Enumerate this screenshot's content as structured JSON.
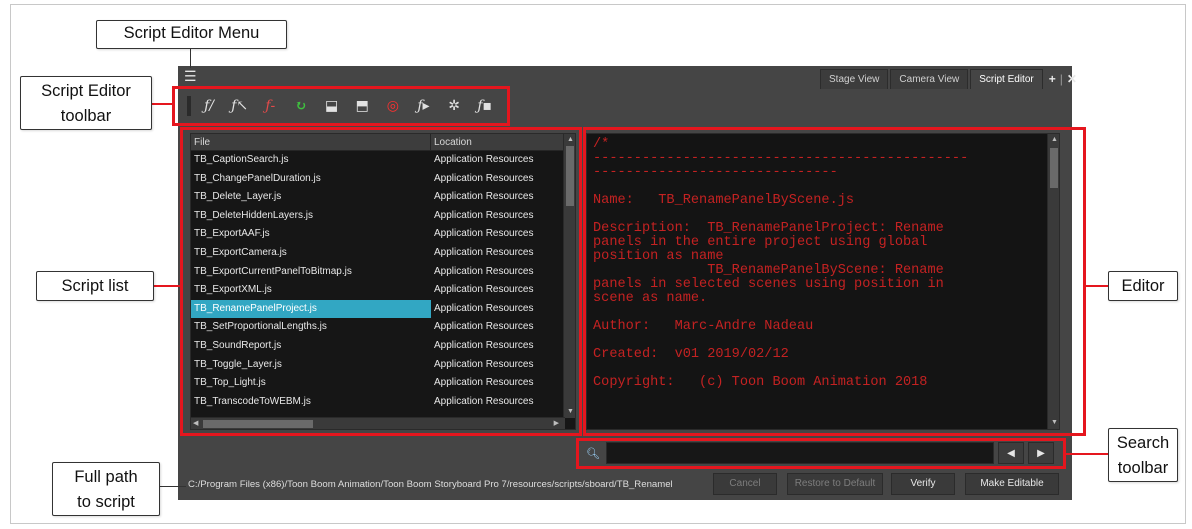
{
  "window": {
    "tabs": [
      {
        "label": "Stage View"
      },
      {
        "label": "Camera View"
      },
      {
        "label": "Script Editor"
      }
    ],
    "tab_controls": {
      "add": "+",
      "sep": "|",
      "close": "✕"
    }
  },
  "toolbar": {
    "buttons": [
      {
        "icon": "ƒ/",
        "name": "new-script-icon"
      },
      {
        "icon": "ƒ↖",
        "name": "import-script-icon"
      },
      {
        "icon": "ƒ-",
        "name": "delete-script-icon"
      },
      {
        "icon": "↻",
        "name": "refresh-icon"
      },
      {
        "icon": "⬓",
        "name": "import-resources-icon"
      },
      {
        "icon": "⬒",
        "name": "export-resources-icon"
      },
      {
        "icon": "◎",
        "name": "set-target-icon"
      },
      {
        "icon": "ƒ▸",
        "name": "run-icon"
      },
      {
        "icon": "✲",
        "name": "debug-icon"
      },
      {
        "icon": "ƒ▪",
        "name": "stop-icon"
      }
    ]
  },
  "script_list": {
    "headers": {
      "file": "File",
      "location": "Location"
    },
    "rows": [
      {
        "file": "TB_CaptionSearch.js",
        "location": "Application Resources"
      },
      {
        "file": "TB_ChangePanelDuration.js",
        "location": "Application Resources"
      },
      {
        "file": "TB_Delete_Layer.js",
        "location": "Application Resources"
      },
      {
        "file": "TB_DeleteHiddenLayers.js",
        "location": "Application Resources"
      },
      {
        "file": "TB_ExportAAF.js",
        "location": "Application Resources"
      },
      {
        "file": "TB_ExportCamera.js",
        "location": "Application Resources"
      },
      {
        "file": "TB_ExportCurrentPanelToBitmap.js",
        "location": "Application Resources"
      },
      {
        "file": "TB_ExportXML.js",
        "location": "Application Resources"
      },
      {
        "file": "TB_RenamePanelProject.js",
        "location": "Application Resources",
        "selected": true
      },
      {
        "file": "TB_SetProportionalLengths.js",
        "location": "Application Resources"
      },
      {
        "file": "TB_SoundReport.js",
        "location": "Application Resources"
      },
      {
        "file": "TB_Toggle_Layer.js",
        "location": "Application Resources"
      },
      {
        "file": "TB_Top_Light.js",
        "location": "Application Resources"
      },
      {
        "file": "TB_TranscodeToWEBM.js",
        "location": "Application Resources"
      }
    ]
  },
  "editor": {
    "code": "/*\n----------------------------------------------\n------------------------------\n\nName:   TB_RenamePanelByScene.js\n\nDescription:  TB_RenamePanelProject: Rename\npanels in the entire project using global\nposition as name\n              TB_RenamePanelByScene: Rename\npanels in selected scenes using position in\nscene as name.\n\nAuthor:   Marc-Andre Nadeau\n\nCreated:  v01 2019/02/12\n\nCopyright:   (c) Toon Boom Animation 2018"
  },
  "search": {
    "value": "",
    "prev": "◀",
    "next": "▶"
  },
  "footer": {
    "path": "C:/Program Files (x86)/Toon Boom Animation/Toon Boom Storyboard Pro 7/resources/scripts/sboard/TB_Renamel",
    "cancel": "Cancel",
    "restore": "Restore to Default",
    "verify": "Verify",
    "make_editable": "Make Editable"
  },
  "callouts": {
    "menu": "Script Editor Menu",
    "toolbar_line1": "Script Editor",
    "toolbar_line2": "toolbar",
    "script_list": "Script list",
    "editor": "Editor",
    "search_line1": "Search",
    "search_line2": "toolbar",
    "path_line1": "Full path",
    "path_line2": "to script"
  },
  "colors": {
    "highlight": "#e5161e",
    "selection": "#32a7c3",
    "code": "#c42222"
  }
}
